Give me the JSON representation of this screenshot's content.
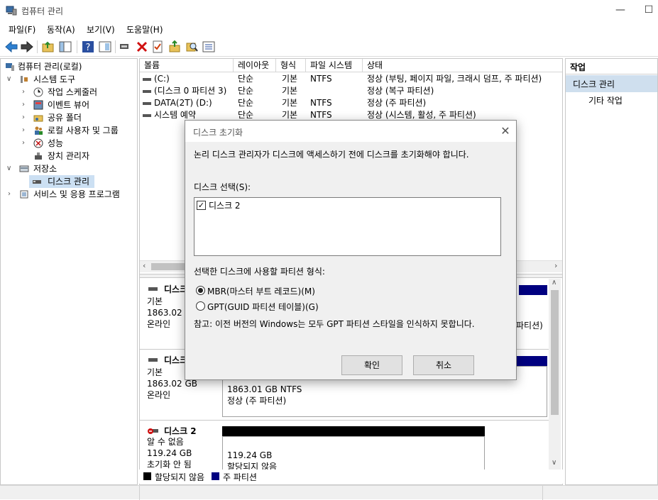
{
  "window": {
    "title": "컴퓨터 관리"
  },
  "menu": [
    "파일(F)",
    "동작(A)",
    "보기(V)",
    "도움말(H)"
  ],
  "tree": {
    "root": "컴퓨터 관리(로컬)",
    "system_tools": "시스템 도구",
    "task_scheduler": "작업 스케줄러",
    "event_viewer": "이벤트 뷰어",
    "shared_folders": "공유 폴더",
    "local_users": "로컬 사용자 및 그룹",
    "performance": "성능",
    "device_manager": "장치 관리자",
    "storage": "저장소",
    "disk_management": "디스크 관리",
    "services": "서비스 및 응용 프로그램"
  },
  "volume_table": {
    "headers": [
      "볼륨",
      "레이아웃",
      "형식",
      "파일 시스템",
      "상태"
    ],
    "rows": [
      {
        "volume": "(C:)",
        "layout": "단순",
        "type": "기본",
        "fs": "NTFS",
        "status": "정상 (부팅, 페이지 파일, 크래시 덤프, 주 파티션)"
      },
      {
        "volume": "(디스크 0 파티션 3)",
        "layout": "단순",
        "type": "기본",
        "fs": "",
        "status": "정상 (복구 파티션)"
      },
      {
        "volume": "DATA(2T) (D:)",
        "layout": "단순",
        "type": "기본",
        "fs": "NTFS",
        "status": "정상 (주 파티션)"
      },
      {
        "volume": "시스템 예약",
        "layout": "단순",
        "type": "기본",
        "fs": "NTFS",
        "status": "정상 (시스템, 활성, 주 파티션)"
      }
    ]
  },
  "disks": [
    {
      "name": "디스크",
      "type": "기본",
      "size": "1863.02 GB",
      "state": "온라인",
      "partial_status": "파티션)"
    },
    {
      "name": "디스크",
      "type": "기본",
      "size": "1863.02 GB",
      "state": "온라인",
      "part_size": "1863.01 GB NTFS",
      "part_status": "정상 (주 파티션)"
    },
    {
      "name": "디스크 2",
      "type": "알 수 없음",
      "size": "119.24 GB",
      "state": "초기화 안 됨",
      "part_size": "119.24 GB",
      "part_status": "할당되지 않음"
    }
  ],
  "legend": [
    {
      "label": "할당되지 않음",
      "color": "#000000"
    },
    {
      "label": "주 파티션",
      "color": "#000080"
    }
  ],
  "actions": {
    "header": "작업",
    "selected": "디스크 관리",
    "more": "기타 작업"
  },
  "dialog": {
    "title": "디스크 초기화",
    "message": "논리 디스크 관리자가 디스크에 액세스하기 전에 디스크를 초기화해야 합니다.",
    "select_label": "디스크 선택(S):",
    "disk_item": "디스크 2",
    "partition_style_label": "선택한 디스크에 사용할 파티션 형식:",
    "mbr_label": "MBR(마스터 부트 레코드)(M)",
    "gpt_label": "GPT(GUID 파티션 테이블)(G)",
    "note": "참고: 이전 버전의 Windows는 모두 GPT 파티션 스타일을 인식하지 못합니다.",
    "ok": "확인",
    "cancel": "취소"
  },
  "colors": {
    "primary_partition": "#000080",
    "unallocated": "#000000",
    "selection": "#cce0f3"
  }
}
